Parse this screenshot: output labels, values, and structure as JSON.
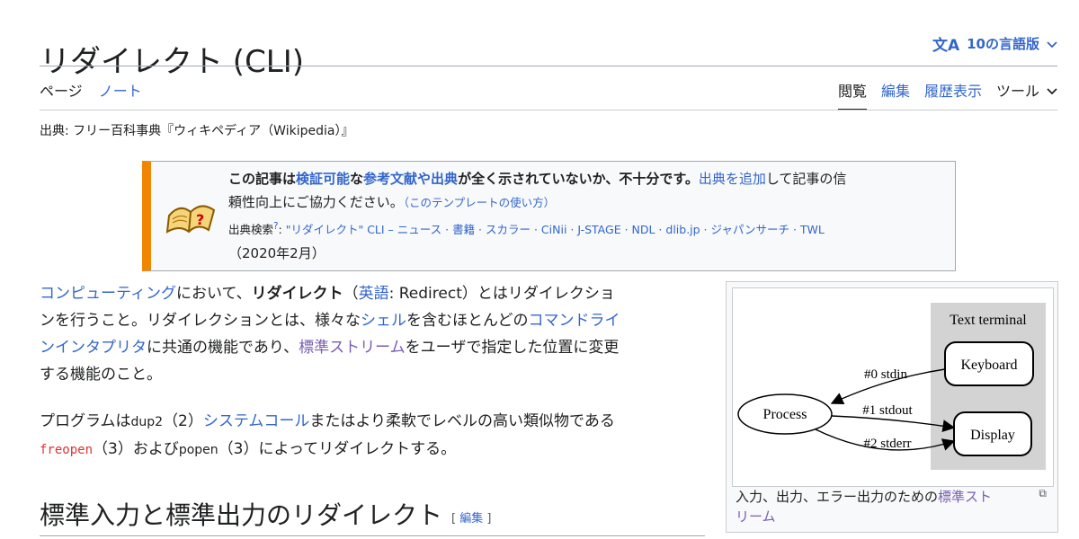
{
  "header": {
    "title": "リダイレクト (CLI)",
    "lang_icon": "文A",
    "lang_label": "10の言語版",
    "lang_chevron": "⌄"
  },
  "tabs_left": [
    "ページ",
    "ノート"
  ],
  "tabs_right": {
    "read": "閲覧",
    "edit": "編集",
    "history": "履歴表示",
    "tools": "ツール",
    "tools_chevron": "⌄"
  },
  "source": "出典: フリー百科事典『ウィキペディア（Wikipedia）』",
  "ambox": {
    "b1": "この記事は",
    "b_link1": "検証可能",
    "b2": "な",
    "b_link2": "参考文献や出典",
    "b3": "が全く示されていないか、不十分です。",
    "link_add": "出典を追加",
    "t1": "して記事の信",
    "t2": "頼性向上にご協力ください。",
    "template_link": "（このテンプレートの使い方）",
    "search_label": "出典検索",
    "search_sup": "?",
    "search_colon": ": ",
    "search_items": "\"リダイレクト\" CLI – ニュース · 書籍 · スカラー · CiNii · J-STAGE · NDL · dlib.jp · ジャパンサーチ · TWL",
    "date": "（2020年2月）"
  },
  "para1": {
    "l_computing": "コンピューティング",
    "t1": "において、",
    "bold": "リダイレクト",
    "t2": "（",
    "l_english": "英語",
    "t3": ": Redirect）とはリダイレクショ",
    "t4": "ンを行うこと。リダイレクションとは、様々な",
    "l_shell": "シェル",
    "t5": "を含むほとんどの",
    "l_cli": "コマンドライ",
    "l_cli2": "ンインタプリタ",
    "t6": "に共通の機能であり、",
    "l_stream": "標準ストリーム",
    "t7": "をユーザで指定した位置に変更",
    "t8": "する機能のこと。"
  },
  "para2": {
    "t1": "プログラムは",
    "dup2": "dup2",
    "t2": "（2）",
    "l_syscall": "システムコール",
    "t3": "またはより柔軟でレベルの高い類似物である",
    "freopen": "freopen",
    "t4": "（3）および",
    "popen": "popen",
    "t5": "（3）によってリダイレクトする。"
  },
  "section": {
    "heading": "標準入力と標準出力のリダイレクト",
    "edit_open": "[ ",
    "edit_label": "編集",
    "edit_close": " ]"
  },
  "figure": {
    "terminal_label": "Text terminal",
    "keyboard": "Keyboard",
    "display": "Display",
    "process": "Process",
    "stdin": "#0 stdin",
    "stdout": "#1 stdout",
    "stderr": "#2 stderr",
    "caption_text": "入力、出力、エラー出力のための",
    "caption_link": "標準スト",
    "caption_link2": "リーム",
    "enlarge_icon": "⧉"
  }
}
